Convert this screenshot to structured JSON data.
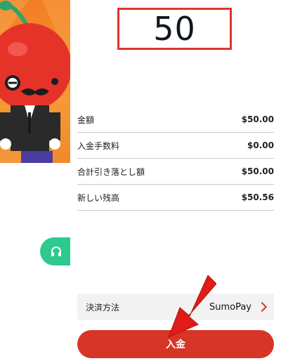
{
  "amount": {
    "value": "50"
  },
  "summary": [
    {
      "label": "金額",
      "value": "$50.00"
    },
    {
      "label": "入金手数料",
      "value": "$0.00"
    },
    {
      "label": "合計引き落とし額",
      "value": "$50.00"
    },
    {
      "label": "新しい残高",
      "value": "$50.56"
    }
  ],
  "payment": {
    "label": "決済方法",
    "value": "SumoPay"
  },
  "deposit_button": {
    "label": "入金"
  },
  "colors": {
    "accent_red": "#d73527",
    "support_green": "#2ec98f",
    "banner_orange": "#f37d23"
  },
  "icons": {
    "support": "headset-icon",
    "payment_chevron": "chevron-right-icon",
    "annotation": "red-arrow-icon"
  }
}
